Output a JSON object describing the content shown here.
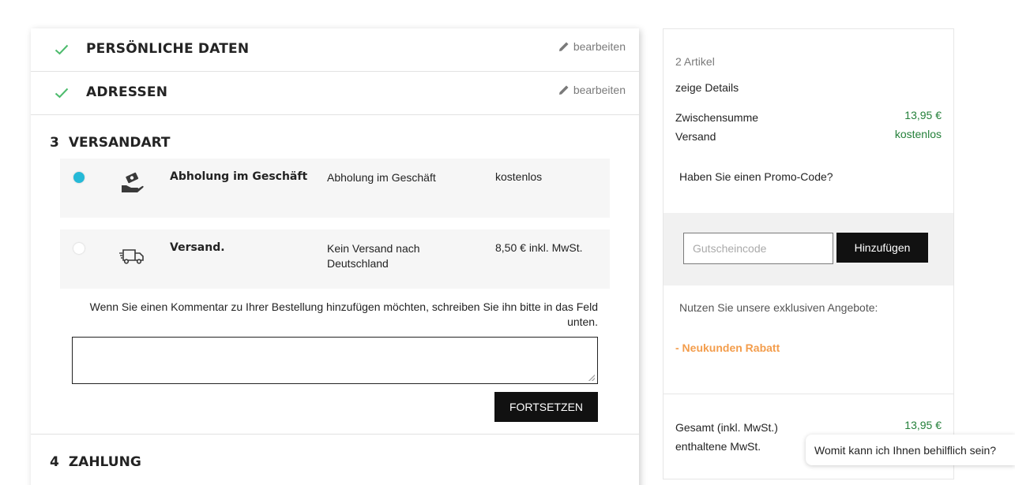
{
  "steps": {
    "personal": {
      "title": "Persönliche Daten",
      "edit_label": "bearbeiten"
    },
    "addresses": {
      "title": "Adressen",
      "edit_label": "bearbeiten"
    },
    "shipping": {
      "number": "3",
      "title": "Versandart",
      "carriers": [
        {
          "name": "Abholung im Geschäft",
          "delay": "Abholung im Geschäft",
          "price": "kostenlos",
          "selected": true,
          "icon": "hand-money-icon"
        },
        {
          "name": "Versand.",
          "delay": "Kein Versand nach Deutschland",
          "price": "8,50 € inkl. MwSt.",
          "selected": false,
          "icon": "delivery-truck-icon"
        }
      ],
      "comment_label": "Wenn Sie einen Kommentar zu Ihrer Bestellung hinzufügen möchten, schreiben Sie ihn bitte in das Feld unten.",
      "comment_value": "",
      "continue_label": "Fortsetzen"
    },
    "payment": {
      "number": "4",
      "title": "Zahlung"
    }
  },
  "summary": {
    "items_count": "2 Artikel",
    "show_details": "zeige Details",
    "subtotal_label": "Zwischensumme",
    "subtotal_value": "13,95 €",
    "shipping_label": "Versand",
    "shipping_value": "kostenlos",
    "promo_question": "Haben Sie einen Promo-Code?",
    "promo_placeholder": "Gutscheincode",
    "promo_button": "Hinzufügen",
    "offers_title": "Nutzen Sie unsere exklusiven Angebote:",
    "offer_item": "- Neukunden Rabatt",
    "total_label": "Gesamt (inkl. MwSt.)",
    "total_value": "13,95 €",
    "tax_label": "enthaltene MwSt."
  },
  "chat": {
    "prompt": "Womit kann ich Ihnen behilflich sein?"
  },
  "colors": {
    "accent_green": "#24803a",
    "check_green": "#4cbb6c",
    "radio_blue": "#25b9d7",
    "offer_orange": "#f39d4c",
    "button_black": "#111111"
  }
}
